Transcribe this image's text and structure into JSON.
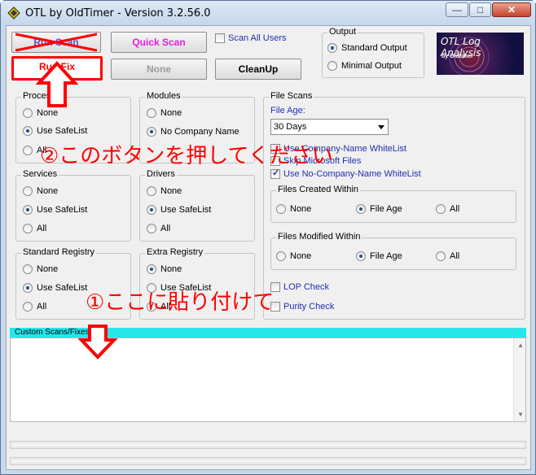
{
  "window": {
    "title": "OTL by OldTimer - Version 3.2.56.0",
    "min_glyph": "—",
    "max_glyph": "□",
    "close_glyph": "✕"
  },
  "toolbar": {
    "run_scan_label": "Run Scan",
    "quick_scan_label": "Quick Scan",
    "run_fix_label": "Run Fix",
    "none_label": "None",
    "cleanup_label": "CleanUp",
    "scan_all_users_label": "Scan All Users"
  },
  "output": {
    "label": "Output",
    "options": [
      "Standard Output",
      "Minimal Output"
    ],
    "selected": 0
  },
  "logo": {
    "title": "OTL Log Analysis",
    "subtitle": "by Oldtimer"
  },
  "groups": {
    "processes": {
      "label": "Processes",
      "options": [
        "None",
        "Use SafeList",
        "All"
      ]
    },
    "modules": {
      "label": "Modules",
      "options": [
        "None",
        "No Company Name"
      ]
    },
    "services": {
      "label": "Services",
      "options": [
        "None",
        "Use SafeList",
        "All"
      ]
    },
    "drivers": {
      "label": "Drivers",
      "options": [
        "None",
        "Use SafeList",
        "All"
      ]
    },
    "standard_registry": {
      "label": "Standard Registry",
      "options": [
        "None",
        "Use SafeList",
        "All"
      ]
    },
    "extra_registry": {
      "label": "Extra Registry",
      "options": [
        "None",
        "Use SafeList",
        "All"
      ]
    }
  },
  "file_scans": {
    "label": "File Scans",
    "file_age_label": "File Age:",
    "file_age_value": "30 Days",
    "use_company_name_whitelist": "Use Company-Name WhiteList",
    "skip_microsoft_files": "Skip Microsoft Files",
    "use_no_company_name_whitelist": "Use No-Company-Name WhiteList",
    "files_created_within": {
      "label": "Files Created Within",
      "options": [
        "None",
        "File Age",
        "All"
      ]
    },
    "files_modified_within": {
      "label": "Files Modified Within",
      "options": [
        "None",
        "File Age",
        "All"
      ]
    },
    "lop_check": "LOP Check",
    "purity_check": "Purity Check"
  },
  "custom_scans": {
    "label": "Custom Scans/Fixes"
  },
  "annotations": {
    "step2": "②このボタンを押してください",
    "step1": "①ここに貼り付けて"
  },
  "colors": {
    "annotation_red": "#ff0000",
    "custom_bar_cyan": "#26e6ea",
    "quick_scan_magenta": "#e020e0",
    "blue_text": "#1f2fb3"
  }
}
